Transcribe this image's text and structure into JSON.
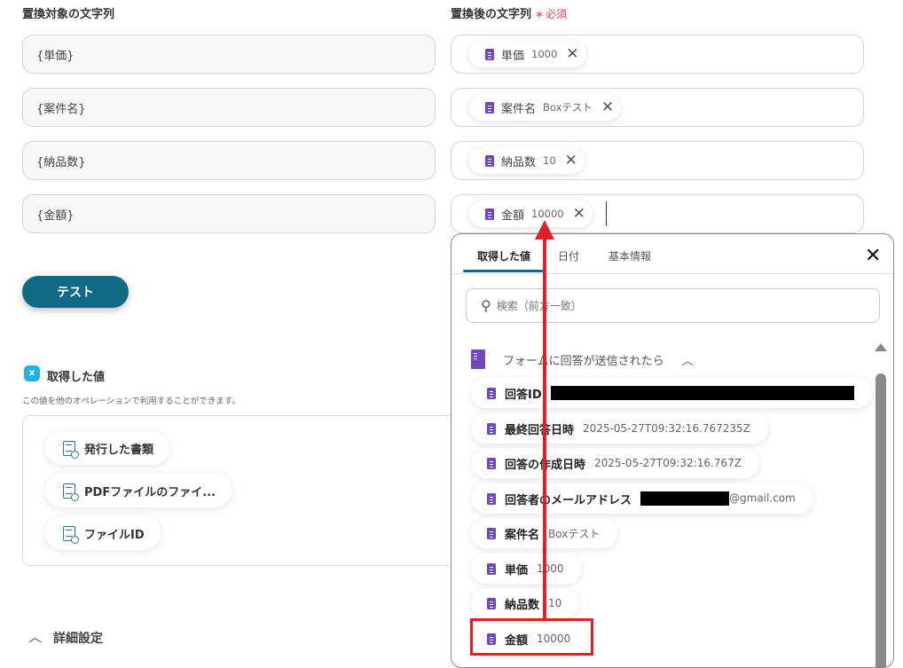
{
  "left": {
    "label": "置換対象の文字列",
    "fields": [
      "{単価}",
      "{案件名}",
      "{納品数}",
      "{金額}"
    ]
  },
  "right": {
    "label": "置換後の文字列",
    "required_mark": "∗",
    "required_text": "必須",
    "chips": [
      {
        "name": "単価",
        "value": "1000"
      },
      {
        "name": "案件名",
        "value": "Boxテスト"
      },
      {
        "name": "納品数",
        "value": "10"
      },
      {
        "name": "金額",
        "value": "10000"
      }
    ]
  },
  "test_button": "テスト",
  "outputs": {
    "title": "取得した値",
    "description": "この値を他のオペレーションで利用することができます。",
    "items": [
      "発行した書類",
      "PDFファイルのファイ...",
      "ファイルID"
    ]
  },
  "advanced": "詳細設定",
  "popup": {
    "tabs": [
      "取得した値",
      "日付",
      "基本情報"
    ],
    "search_placeholder": "検索（前方一致）",
    "group": "フォームに回答が送信されたら",
    "items": [
      {
        "name": "回答ID",
        "value": ""
      },
      {
        "name": "最終回答日時",
        "value": "2025-05-27T09:32:16.767235Z"
      },
      {
        "name": "回答の作成日時",
        "value": "2025-05-27T09:32:16.767Z"
      },
      {
        "name": "回答者のメールアドレス",
        "value": "@gmail.com"
      },
      {
        "name": "案件名",
        "value": "Boxテスト"
      },
      {
        "name": "単価",
        "value": "1000"
      },
      {
        "name": "納品数",
        "value": "10"
      },
      {
        "name": "金額",
        "value": "10000"
      }
    ]
  },
  "colors": {
    "accent": "#0f6a85",
    "annotation": "#e31e24",
    "form_icon": "#7248b9"
  }
}
